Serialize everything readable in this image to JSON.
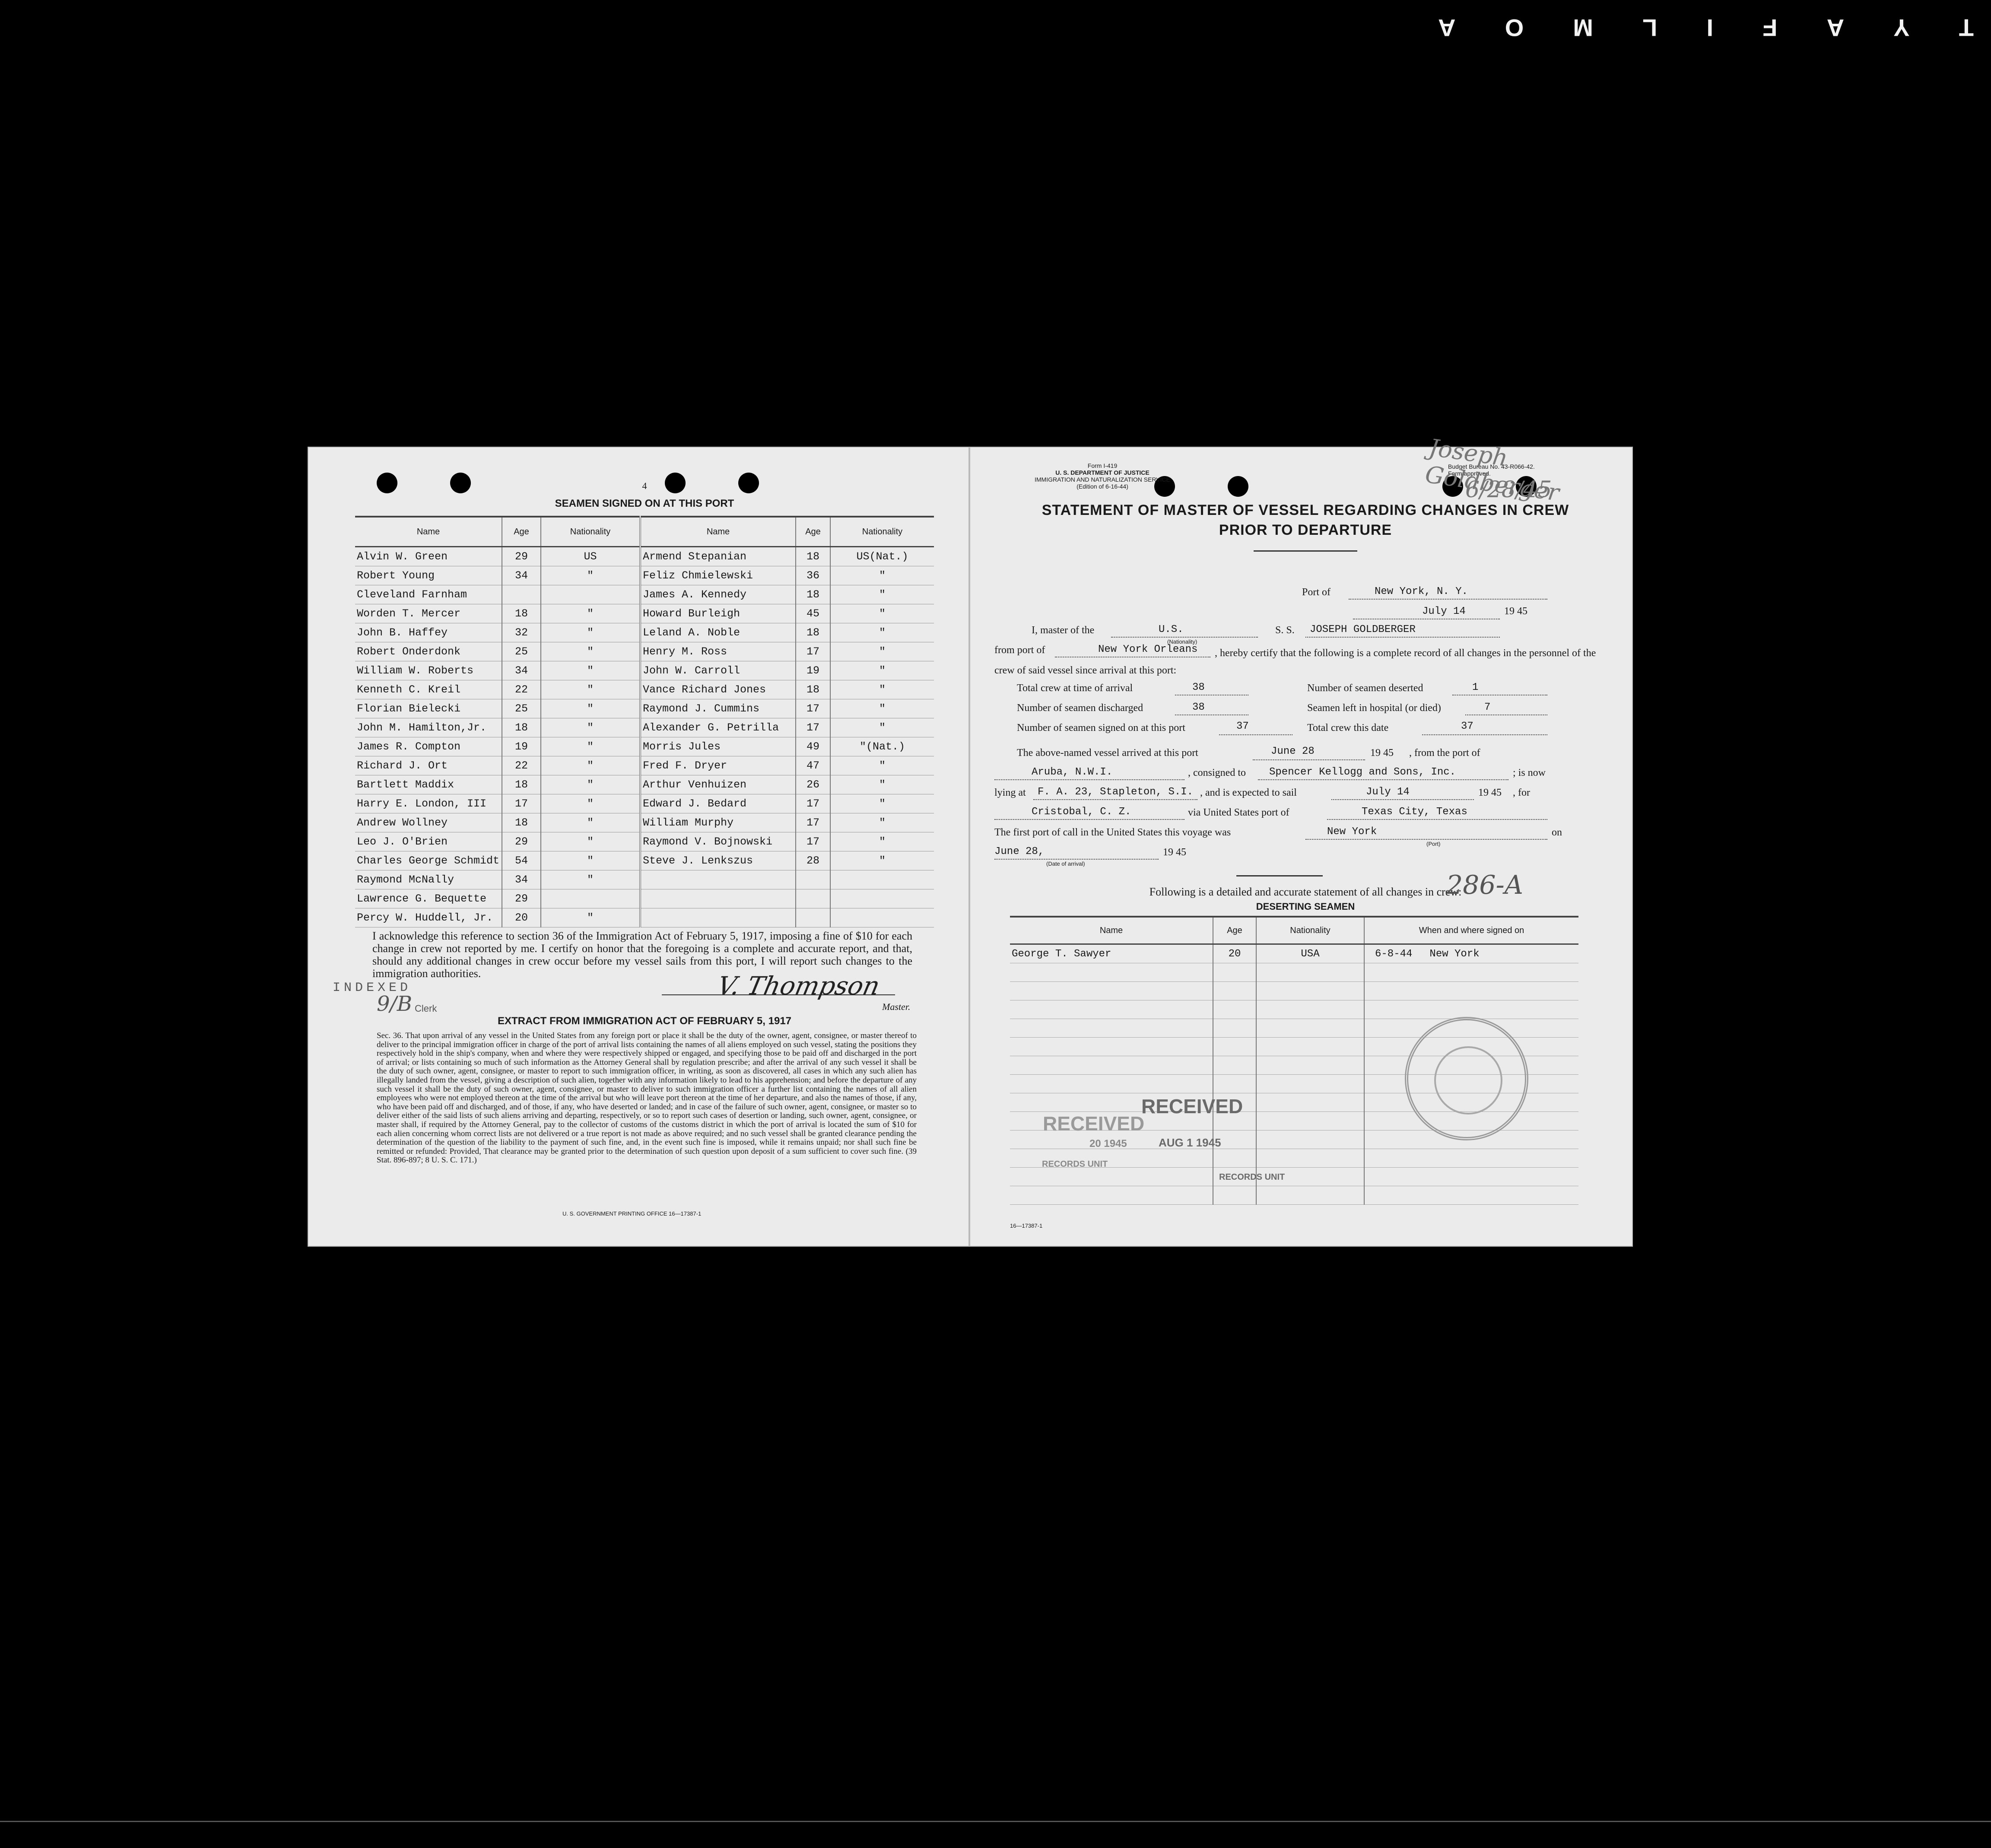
{
  "filmstrip": [
    "T",
    "Y",
    "A",
    "F",
    "I",
    "L",
    "M",
    "O",
    "A"
  ],
  "left_page": {
    "page_number": "4",
    "title": "SEAMEN SIGNED ON AT THIS PORT",
    "headers": {
      "name": "Name",
      "age": "Age",
      "nationality": "Nationality"
    },
    "rows": [
      {
        "name1": "Alvin W. Green",
        "age1": "29",
        "nat1": "US",
        "name2": "Armend Stepanian",
        "age2": "18",
        "nat2": "US(Nat.)"
      },
      {
        "name1": "Robert Young",
        "age1": "34",
        "nat1": "\"",
        "name2": "Feliz Chmielewski",
        "age2": "36",
        "nat2": "\""
      },
      {
        "name1": "Cleveland Farnham",
        "age1": "",
        "nat1": "",
        "name2": "James A. Kennedy",
        "age2": "18",
        "nat2": "\""
      },
      {
        "name1": "Worden T. Mercer",
        "age1": "18",
        "nat1": "\"",
        "name2": "Howard Burleigh",
        "age2": "45",
        "nat2": "\""
      },
      {
        "name1": "John B. Haffey",
        "age1": "32",
        "nat1": "\"",
        "name2": "Leland A. Noble",
        "age2": "18",
        "nat2": "\""
      },
      {
        "name1": "Robert Onderdonk",
        "age1": "25",
        "nat1": "\"",
        "name2": "Henry M. Ross",
        "age2": "17",
        "nat2": "\""
      },
      {
        "name1": "William W. Roberts",
        "age1": "34",
        "nat1": "\"",
        "name2": "John W. Carroll",
        "age2": "19",
        "nat2": "\""
      },
      {
        "name1": "Kenneth C. Kreil",
        "age1": "22",
        "nat1": "\"",
        "name2": "Vance Richard Jones",
        "age2": "18",
        "nat2": "\""
      },
      {
        "name1": "Florian Bielecki",
        "age1": "25",
        "nat1": "\"",
        "name2": "Raymond J. Cummins",
        "age2": "17",
        "nat2": "\""
      },
      {
        "name1": "John M. Hamilton,Jr.",
        "age1": "18",
        "nat1": "\"",
        "name2": "Alexander G. Petrilla",
        "age2": "17",
        "nat2": "\""
      },
      {
        "name1": "James R. Compton",
        "age1": "19",
        "nat1": "\"",
        "name2": "Morris Jules",
        "age2": "49",
        "nat2": "\"(Nat.)"
      },
      {
        "name1": "Richard J. Ort",
        "age1": "22",
        "nat1": "\"",
        "name2": "Fred F. Dryer",
        "age2": "47",
        "nat2": "\""
      },
      {
        "name1": "Bartlett Maddix",
        "age1": "18",
        "nat1": "\"",
        "name2": "Arthur Venhuizen",
        "age2": "26",
        "nat2": "\""
      },
      {
        "name1": "Harry E. London, III",
        "age1": "17",
        "nat1": "\"",
        "name2": "Edward J. Bedard",
        "age2": "17",
        "nat2": "\""
      },
      {
        "name1": "Andrew Wollney",
        "age1": "18",
        "nat1": "\"",
        "name2": "William Murphy",
        "age2": "17",
        "nat2": "\""
      },
      {
        "name1": "Leo J. O'Brien",
        "age1": "29",
        "nat1": "\"",
        "name2": "Raymond V. Bojnowski",
        "age2": "17",
        "nat2": "\""
      },
      {
        "name1": "Charles George Schmidt",
        "age1": "54",
        "nat1": "\"",
        "name2": "Steve J. Lenkszus",
        "age2": "28",
        "nat2": "\""
      },
      {
        "name1": "Raymond McNally",
        "age1": "34",
        "nat1": "\"",
        "name2": "",
        "age2": "",
        "nat2": ""
      },
      {
        "name1": "Lawrence G. Bequette",
        "age1": "29",
        "nat1": "",
        "name2": "",
        "age2": "",
        "nat2": ""
      },
      {
        "name1": "Percy W. Huddell, Jr.",
        "age1": "20",
        "nat1": "\"",
        "name2": "",
        "age2": "",
        "nat2": ""
      }
    ],
    "acknowledgement": "I acknowledge this reference to section 36 of the Immigration Act of February 5, 1917, imposing a fine of $10 for each change in crew not reported by me. I certify on honor that the foregoing is a complete and accurate report, and that, should any additional changes in crew occur before my vessel sails from this port, I will report such changes to the immigration authorities.",
    "signature": "V. Thompson",
    "master_label": "Master.",
    "indexed": "INDEXED",
    "indexed_mark": "9/B",
    "clerk": "Clerk",
    "extract_title": "EXTRACT FROM IMMIGRATION ACT OF FEBRUARY 5, 1917",
    "extract_text": "Sec. 36. That upon arrival of any vessel in the United States from any foreign port or place it shall be the duty of the owner, agent, consignee, or master thereof to deliver to the principal immigration officer in charge of the port of arrival lists containing the names of all aliens employed on such vessel, stating the positions they respectively hold in the ship's company, when and where they were respectively shipped or engaged, and specifying those to be paid off and discharged in the port of arrival; or lists containing so much of such information as the Attorney General shall by regulation prescribe; and after the arrival of any such vessel it shall be the duty of such owner, agent, consignee, or master to report to such immigration officer, in writing, as soon as discovered, all cases in which any such alien has illegally landed from the vessel, giving a description of such alien, together with any information likely to lead to his apprehension; and before the departure of any such vessel it shall be the duty of such owner, agent, consignee, or master to deliver to such immigration officer a further list containing the names of all alien employees who were not employed thereon at the time of the arrival but who will leave port thereon at the time of her departure, and also the names of those, if any, who have been paid off and discharged, and of those, if any, who have deserted or landed; and in case of the failure of such owner, agent, consignee, or master so to deliver either of the said lists of such aliens arriving and departing, respectively, or so to report such cases of desertion or landing, such owner, agent, consignee, or master shall, if required by the Attorney General, pay to the collector of customs of the customs district in which the port of arrival is located the sum of $10 for each alien concerning whom correct lists are not delivered or a true report is not made as above required; and no such vessel shall be granted clearance pending the determination of the question of the liability to the payment of such fine, and, in the event such fine is imposed, while it remains unpaid; nor shall such fine be remitted or refunded: Provided, That clearance may be granted prior to the determination of such question upon deposit of a sum sufficient to cover such fine. (39 Stat. 896-897; 8 U. S. C. 171.)",
    "gpo": "U. S. GOVERNMENT PRINTING OFFICE 16—17387-1"
  },
  "right_page": {
    "form_id": "Form I-419",
    "department": "U. S. DEPARTMENT OF JUSTICE",
    "service": "IMMIGRATION AND NATURALIZATION SERVICE",
    "edition": "(Edition of 6-16-44)",
    "budget": "Budget Bureau No. 43-R066-42.",
    "approved": "Form approved.",
    "scribble": "Joseph Goldberger",
    "scribble2": "6/28/45",
    "title_line1": "STATEMENT OF MASTER OF VESSEL REGARDING CHANGES IN CREW",
    "title_line2": "PRIOR TO DEPARTURE",
    "port_label": "Port of",
    "port_value": "New York, N. Y.",
    "date_value": "July 14",
    "year_value": "19 45",
    "master_of": "I, master of the",
    "nationality_value": "U.S.",
    "nationality_caption": "(Nationality)",
    "ss_label": "S. S.",
    "vessel": "JOSEPH GOLDBERGER",
    "from_port_label": "from port of",
    "from_port_value": "New York Orleans",
    "certify_text": ", hereby certify that the following is a complete record of all changes in the personnel of the crew of said vessel since arrival at this port:",
    "total_crew_arrival_label": "Total crew at time of arrival",
    "total_crew_arrival": "38",
    "deserted_label": "Number of seamen deserted",
    "deserted": "1",
    "discharged_label": "Number of seamen discharged",
    "discharged": "38",
    "hospital_label": "Seamen left in hospital (or died)",
    "hospital": "7",
    "signed_on_label": "Number of seamen signed on at this port",
    "signed_on": "37",
    "total_today_label": "Total crew this date",
    "total_today": "37",
    "arrived_label": "The above-named vessel arrived at this port",
    "arrived_date": "June 28",
    "arrived_year": "19 45",
    "from_port_of": ", from the port of",
    "arrived_from": "Aruba, N.W.I.",
    "consigned_label": ", consigned to",
    "consignee": "Spencer Kellogg and Sons, Inc.",
    "is_now": "; is now",
    "lying_label": "lying at",
    "lying_at": "F. A. 23, Stapleton, S.I.",
    "sail_label": ", and is expected to sail",
    "sail_date": "July 14",
    "sail_year": "19 45",
    "for_label": ", for",
    "destination": "Cristobal, C. Z.",
    "via_label": "via United States port of",
    "via_port": "Texas City, Texas",
    "first_port_label": "The first port of call in the United States this voyage was",
    "first_port": "New York",
    "port_caption": "(Port)",
    "on_label": "on",
    "first_date": "June 28,",
    "first_year": "19 45",
    "date_arrival_caption": "(Date of arrival)",
    "following_label": "Following is a detailed and accurate statement of all changes in crew:",
    "mark_286": "286-A",
    "deserting_title": "DESERTING SEAMEN",
    "des_headers": {
      "name": "Name",
      "age": "Age",
      "nationality": "Nationality",
      "when": "When and where signed on"
    },
    "deserting": [
      {
        "name": "George T. Sawyer",
        "age": "20",
        "nat": "USA",
        "date": "6-8-44",
        "place": "New York"
      }
    ],
    "stamp_received1": "RECEIVED",
    "stamp_received2": "RECEIVED",
    "stamp_date1": "AUG 1 1945",
    "stamp_date2": "20 1945",
    "stamp_records1": "RECORDS UNIT",
    "stamp_records2": "RECORDS UNIT",
    "form_number": "16—17387-1"
  }
}
